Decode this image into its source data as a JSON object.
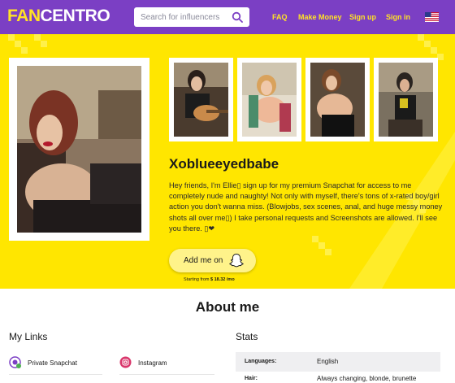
{
  "header": {
    "logo_fan": "FAN",
    "logo_centro": "CENTRO",
    "search_placeholder": "Search for influencers",
    "nav": {
      "faq": "FAQ",
      "make_money": "Make Money",
      "sign_up": "Sign up",
      "sign_in": "Sign in"
    },
    "flag": "us-flag-icon"
  },
  "profile": {
    "name": "Xoblueeyedbabe",
    "bio": "Hey friends, I'm Ellie▯ sign up for my premium Snapchat for access to me completely nude and naughty! Not only with myself, there's tons of x-rated boy/girl action you don't wanna miss. (Blowjobs, sex scenes, anal, and huge messy money shots all over me▯) I take personal requests and Screenshots are allowed. I'll see you there. ▯❤",
    "cta_label": "Add me on",
    "cta_icon": "snapchat-ghost-icon",
    "starting_prefix": "Starting from",
    "starting_price": "$ 18.32 /mo"
  },
  "about": {
    "title": "About me",
    "links_title": "My Links",
    "links": [
      {
        "label": "Private Snapchat",
        "icon": "snapchat-icon"
      },
      {
        "label": "Instagram",
        "icon": "instagram-icon"
      }
    ],
    "stats_title": "Stats",
    "stats": [
      {
        "key": "Languages:",
        "value": "English"
      },
      {
        "key": "Hair:",
        "value": "Always changing, blonde, brunette"
      }
    ]
  },
  "colors": {
    "header_bg": "#7b3fc4",
    "accent_yellow": "#ffe600",
    "logo_yellow": "#ffe226"
  }
}
